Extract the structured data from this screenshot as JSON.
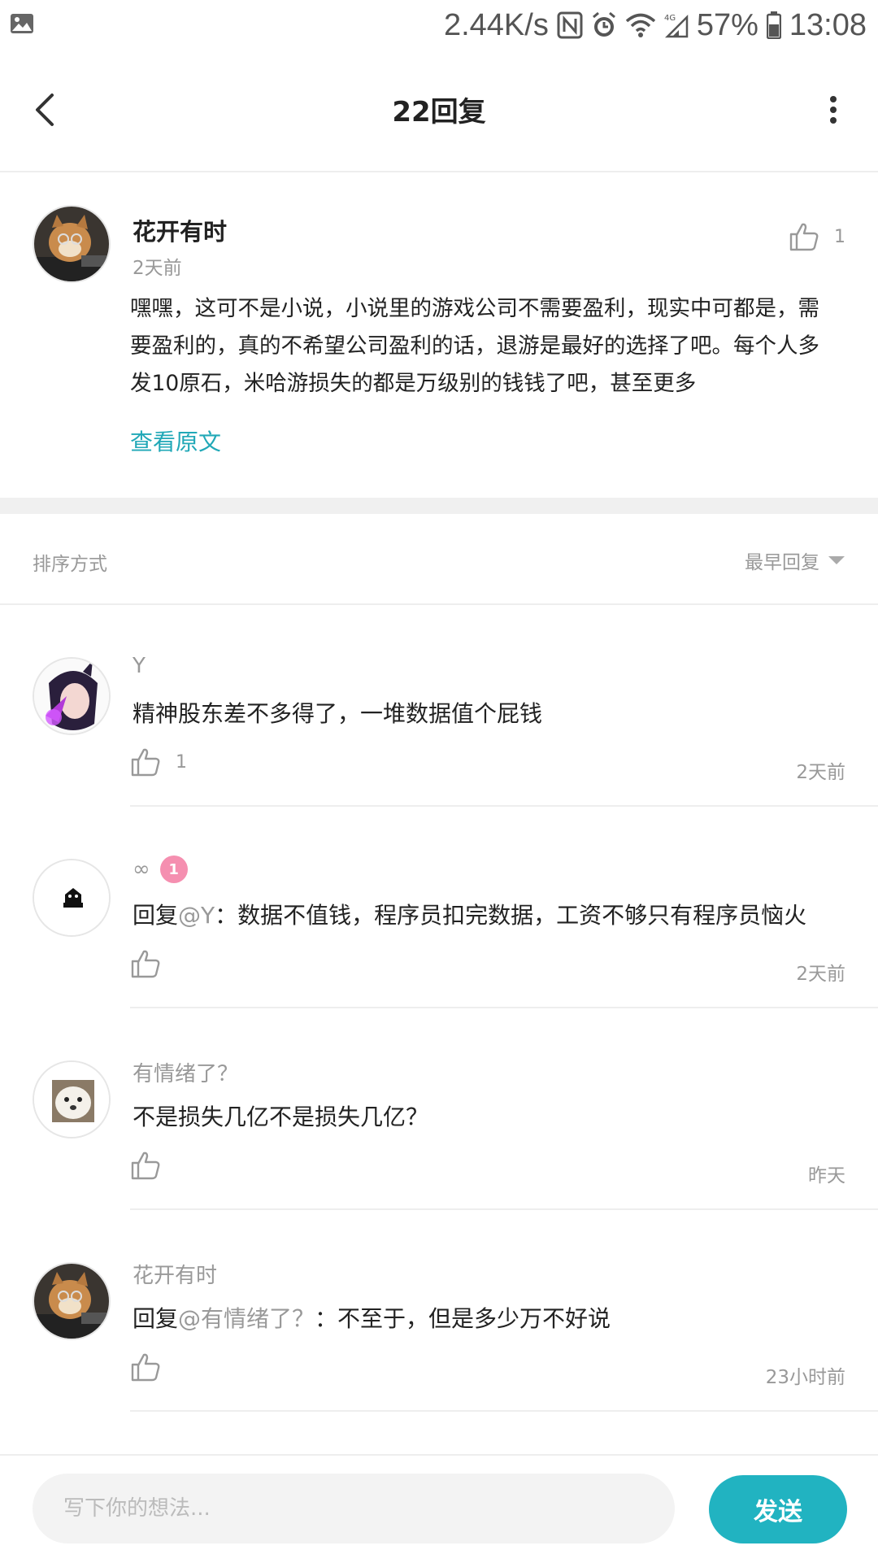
{
  "status_bar": {
    "speed": "2.44K/s",
    "battery": "57%",
    "time": "13:08",
    "icons": [
      "image-icon",
      "nfc-icon",
      "alarm-icon",
      "wifi-icon",
      "signal-icon",
      "battery-icon"
    ]
  },
  "header": {
    "title": "22回复"
  },
  "op": {
    "name": "花开有时",
    "time": "2天前",
    "likes": "1",
    "content": "嘿嘿，这可不是小说，小说里的游戏公司不需要盈利，现实中可都是，需要盈利的，真的不希望公司盈利的话，退游是最好的选择了吧。每个人多发10原石，米哈游损失的都是万级别的钱钱了吧，甚至更多",
    "view_original": "查看原文"
  },
  "sort": {
    "label": "排序方式",
    "value": "最早回复"
  },
  "replies": [
    {
      "name": "Y",
      "text": "精神股东差不多得了，一堆数据值个屁钱",
      "likes": "1",
      "time": "2天前"
    },
    {
      "name": "∞",
      "badge": "1",
      "prefix": "回复",
      "mention": "@Y",
      "text": "：数据不值钱，程序员扣完数据，工资不够只有程序员恼火",
      "likes": "",
      "time": "2天前"
    },
    {
      "name": "有情绪了？",
      "text": "不是损失几亿不是损失几亿？",
      "likes": "",
      "time": "昨天"
    },
    {
      "name": "花开有时",
      "prefix": "回复",
      "mention": "@有情绪了？",
      "text": "：不至于，但是多少万不好说",
      "likes": "",
      "time": "23小时前"
    }
  ],
  "composer": {
    "placeholder": "写下你的想法...",
    "send_label": "发送"
  },
  "colors": {
    "accent": "#21b3c1",
    "link": "#21a8b7",
    "muted": "#999999"
  }
}
